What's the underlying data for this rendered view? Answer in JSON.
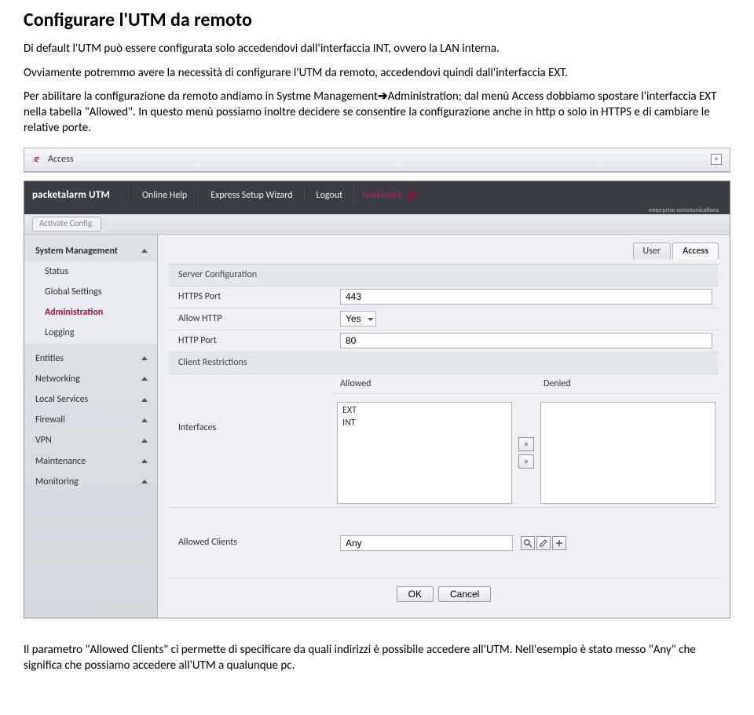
{
  "doc": {
    "title": "Configurare l'UTM da remoto",
    "p1": "Di default l'UTM può essere configurata solo accedendovi dall'interfaccia INT, ovvero la LAN interna.",
    "p2": "Ovviamente potremmo avere la necessità di configurare l'UTM da remoto, accedendovi quindi dall'interfaccia EXT.",
    "p3a": "Per abilitare la configurazione da remoto andiamo in Systme Management",
    "p3b": "Administration; dal menù Access dobbiamo spostare l'interfaccia EXT nella tabella \"Allowed\". In questo menù possiamo inoltre decidere se consentire la configurazione anche in http o solo in HTTPS e di cambiare le relative porte.",
    "p4": "Il parametro \"Allowed Clients\" ci permette di specificare da quali indirizzi è possibile accedere all'UTM. Nell'esempio è stato messo \"Any\" che significa che possiamo accedere all'UTM a qualunque pc."
  },
  "accessHeader": {
    "label": "Access"
  },
  "app": {
    "brand": "packetalarm UTM",
    "topnav": [
      "Online Help",
      "Express Setup Wizard",
      "Logout"
    ],
    "logo_text": "funkwerk",
    "logo_sub": "enterprise communications",
    "activate": "Activate Config."
  },
  "sidebar": {
    "items": [
      {
        "label": "System Management",
        "expandable": true
      },
      {
        "label": "Status",
        "sub": true
      },
      {
        "label": "Global Settings",
        "sub": true
      },
      {
        "label": "Administration",
        "sub": true,
        "active": true
      },
      {
        "label": "Logging",
        "sub": true
      },
      {
        "label": "Entities",
        "expandable": true
      },
      {
        "label": "Networking",
        "expandable": true
      },
      {
        "label": "Local Services",
        "expandable": true
      },
      {
        "label": "Firewall",
        "expandable": true
      },
      {
        "label": "VPN",
        "expandable": true
      },
      {
        "label": "Maintenance",
        "expandable": true
      },
      {
        "label": "Monitoring",
        "expandable": true
      }
    ]
  },
  "tabs": {
    "user": "User",
    "access": "Access"
  },
  "form": {
    "server_config": "Server Configuration",
    "https_port_label": "HTTPS Port",
    "https_port_value": "443",
    "allow_http_label": "Allow HTTP",
    "allow_http_value": "Yes",
    "http_port_label": "HTTP Port",
    "http_port_value": "80",
    "client_restrictions": "Client Restrictions",
    "allowed_header": "Allowed",
    "denied_header": "Denied",
    "interfaces_label": "Interfaces",
    "allowed_list": [
      "EXT",
      "INT"
    ],
    "allowed_clients_label": "Allowed Clients",
    "allowed_clients_value": "Any",
    "ok": "OK",
    "cancel": "Cancel"
  }
}
